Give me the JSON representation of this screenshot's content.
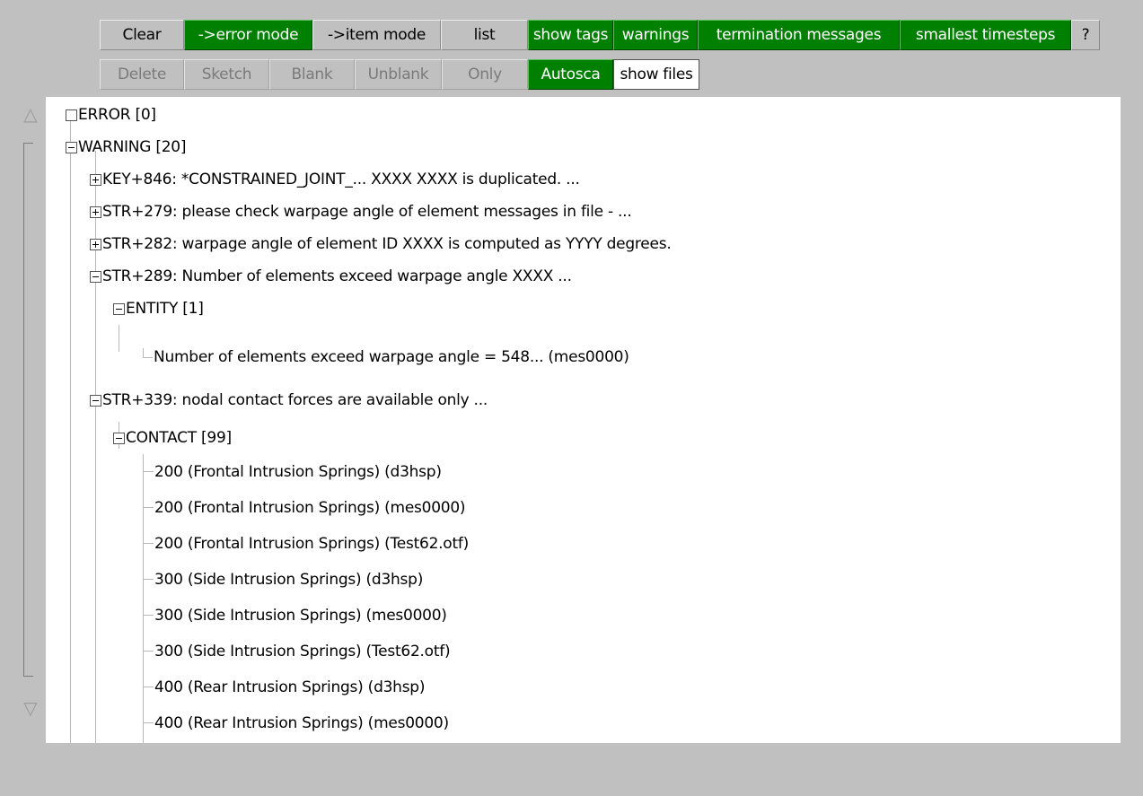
{
  "toolbar": {
    "row1": [
      {
        "label": "Clear",
        "style": "grey"
      },
      {
        "label": "->error mode",
        "style": "green"
      },
      {
        "label": "->item mode",
        "style": "grey"
      },
      {
        "label": "list",
        "style": "grey"
      },
      {
        "label": "show tags",
        "style": "green"
      },
      {
        "label": "warnings",
        "style": "green"
      },
      {
        "label": "termination messages",
        "style": "green"
      },
      {
        "label": "smallest timesteps",
        "style": "green"
      },
      {
        "label": "?",
        "style": "grey"
      }
    ],
    "row2": [
      {
        "label": "Delete",
        "style": "dim"
      },
      {
        "label": "Sketch",
        "style": "dim"
      },
      {
        "label": "Blank",
        "style": "dim"
      },
      {
        "label": "Unblank",
        "style": "dim"
      },
      {
        "label": "Only",
        "style": "dim"
      },
      {
        "label": "Autosca",
        "style": "green"
      },
      {
        "label": "show files",
        "style": "selected"
      }
    ]
  },
  "scrollbar": {
    "up_icon": "triangle-up-outline-icon",
    "down_icon": "triangle-down-outline-icon",
    "up_glyph": "△",
    "down_glyph": "▽"
  },
  "tree": {
    "rows": [
      {
        "text": "ERROR [0]",
        "level": 0,
        "toggle": "empty"
      },
      {
        "text": "WARNING [20]",
        "level": 0,
        "toggle": "minus"
      },
      {
        "text": "KEY+846: *CONSTRAINED_JOINT_... XXXX XXXX is duplicated. ...",
        "level": 1,
        "toggle": "plus"
      },
      {
        "text": "STR+279: please check warpage angle of element messages in file - ...",
        "level": 1,
        "toggle": "plus"
      },
      {
        "text": "STR+282: warpage angle of element ID XXXX is computed as YYYY degrees.",
        "level": 1,
        "toggle": "plus"
      },
      {
        "text": "STR+289: Number of elements exceed warpage angle  XXXX ...",
        "level": 1,
        "toggle": "minus"
      },
      {
        "text": "ENTITY [1]",
        "level": 2,
        "toggle": "minus"
      },
      {
        "text": "Number of elements exceed warpage angle = 548... (mes0000)",
        "level": 3,
        "toggle": "leaf"
      },
      {
        "text": "STR+339: nodal contact forces are available only ...",
        "level": 1,
        "toggle": "minus"
      },
      {
        "text": "CONTACT [99]",
        "level": 2,
        "toggle": "minus"
      },
      {
        "text": "200 (Frontal Intrusion Springs) (d3hsp)",
        "level": 3,
        "toggle": "leaf"
      },
      {
        "text": "200 (Frontal Intrusion Springs) (mes0000)",
        "level": 3,
        "toggle": "leaf"
      },
      {
        "text": "200 (Frontal Intrusion Springs) (Test62.otf)",
        "level": 3,
        "toggle": "leaf"
      },
      {
        "text": "300 (Side Intrusion Springs) (d3hsp)",
        "level": 3,
        "toggle": "leaf"
      },
      {
        "text": "300 (Side Intrusion Springs) (mes0000)",
        "level": 3,
        "toggle": "leaf"
      },
      {
        "text": "300 (Side Intrusion Springs) (Test62.otf)",
        "level": 3,
        "toggle": "leaf"
      },
      {
        "text": "400 (Rear Intrusion Springs) (d3hsp)",
        "level": 3,
        "toggle": "leaf"
      },
      {
        "text": "400 (Rear Intrusion Springs) (mes0000)",
        "level": 3,
        "toggle": "leaf"
      }
    ]
  }
}
